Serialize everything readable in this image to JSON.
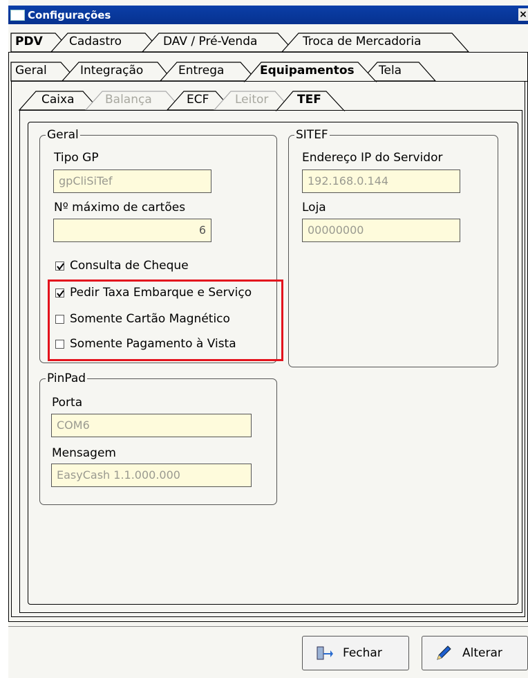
{
  "window": {
    "title": "Configurações",
    "close_glyph": "×"
  },
  "tabs_level1": [
    {
      "label": "PDV",
      "active": true
    },
    {
      "label": "Cadastro"
    },
    {
      "label": "DAV / Pré-Venda"
    },
    {
      "label": "Troca de Mercadoria"
    }
  ],
  "tabs_level2": [
    {
      "label": "Geral"
    },
    {
      "label": "Integração"
    },
    {
      "label": "Entrega"
    },
    {
      "label": "Equipamentos",
      "active": true
    },
    {
      "label": "Tela"
    }
  ],
  "tabs_level3": [
    {
      "label": "Caixa"
    },
    {
      "label": "Balança",
      "disabled": true
    },
    {
      "label": "ECF"
    },
    {
      "label": "Leitor",
      "disabled": true
    },
    {
      "label": "TEF",
      "active": true
    }
  ],
  "geral": {
    "legend": "Geral",
    "tipo_gp_label": "Tipo GP",
    "tipo_gp_value": "gpCliSiTef",
    "max_cartoes_label": "Nº máximo de cartões",
    "max_cartoes_value": "6",
    "consulta_cheque": {
      "label": "Consulta de Cheque",
      "checked": true
    },
    "pedir_taxa": {
      "label": "Pedir Taxa Embarque e Serviço",
      "checked": true
    },
    "somente_cartao": {
      "label": "Somente Cartão Magnético",
      "checked": false
    },
    "somente_pagamento": {
      "label": "Somente Pagamento à Vista",
      "checked": false
    }
  },
  "sitef": {
    "legend": "SITEF",
    "ip_label": "Endereço IP do Servidor",
    "ip_value": "192.168.0.144",
    "loja_label": "Loja",
    "loja_value": "00000000"
  },
  "pinpad": {
    "legend": "PinPad",
    "porta_label": "Porta",
    "porta_value": "COM6",
    "mensagem_label": "Mensagem",
    "mensagem_value": "EasyCash 1.1.000.000"
  },
  "buttons": {
    "fechar": {
      "label": "Fechar",
      "icon": "exit-door-icon"
    },
    "alterar": {
      "label": "Alterar",
      "icon": "pencil-icon"
    }
  },
  "colors": {
    "titlebar": "#0b3fa8",
    "highlight": "#e3131d",
    "field_bg": "#fefbdc"
  }
}
